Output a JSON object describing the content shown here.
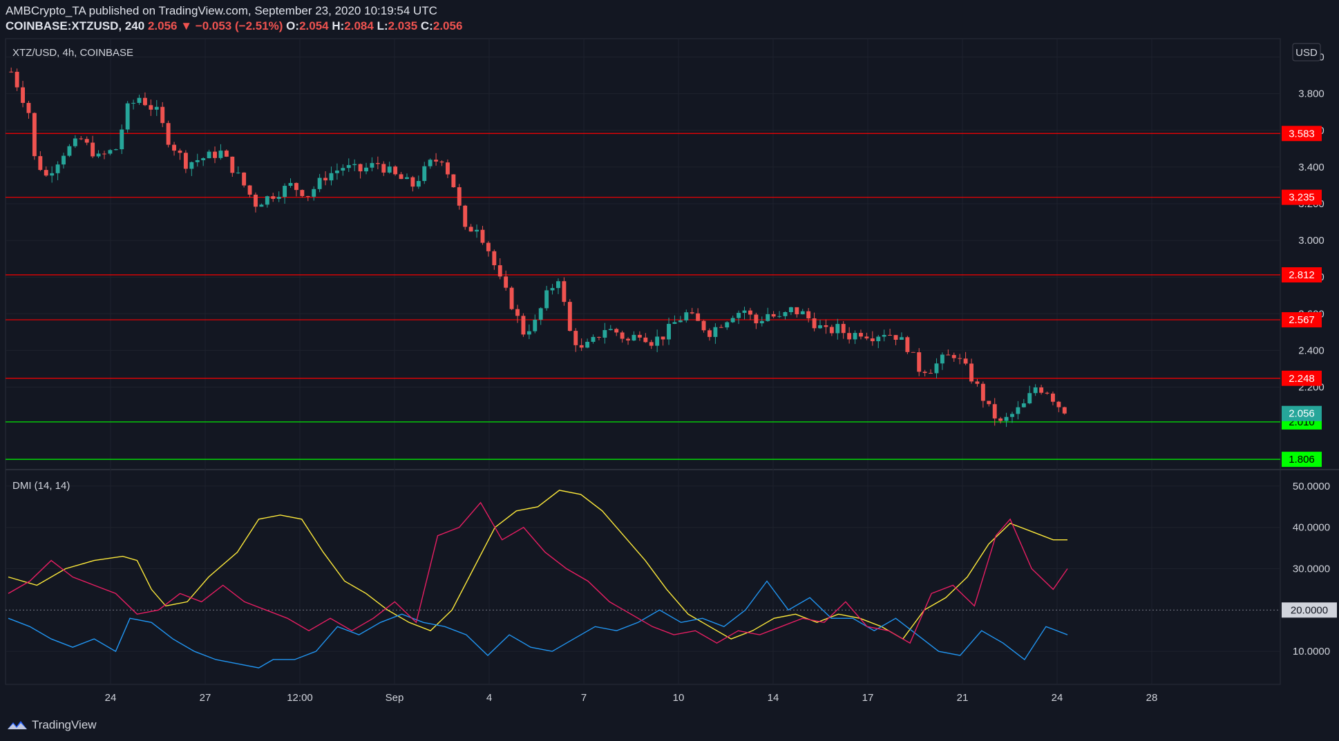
{
  "header": {
    "published_line": "AMBCrypto_TA published on TradingView.com, September 23, 2020 10:19:54 UTC",
    "symbol": "COINBASE:XTZUSD, 240",
    "last": "2.056",
    "change_arrow": "▼",
    "change": "−0.053 (−2.51%)",
    "open_label": "O:",
    "open": "2.054",
    "high_label": "H:",
    "high": "2.084",
    "low_label": "L:",
    "low": "2.035",
    "close_label": "C:",
    "close": "2.056"
  },
  "pane_title": "XTZ/USD, 4h, COINBASE",
  "currency_button": "USD",
  "indicator_title": "DMI (14, 14)",
  "footer_brand": "TradingView",
  "colors": {
    "background": "#131722",
    "up": "#26a69a",
    "down": "#ef5350",
    "resistance": "#ff0000",
    "support": "#00ff00",
    "adx": "#ffeb3b",
    "plus_di": "#2196f3",
    "minus_di": "#e91e63"
  },
  "chart_data": [
    {
      "type": "candlestick",
      "title": "XTZ/USD, 4h, COINBASE",
      "ylim": [
        1.75,
        4.1
      ],
      "y_ticks": [
        "4.000",
        "3.800",
        "3.600",
        "3.400",
        "3.200",
        "3.000",
        "2.800",
        "2.600",
        "2.400",
        "2.200"
      ],
      "x_ticks": [
        "24",
        "27",
        "12:00",
        "Sep",
        "4",
        "7",
        "10",
        "14",
        "17",
        "21",
        "24",
        "28"
      ],
      "close_points": [
        [
          0,
          3.92
        ],
        [
          1,
          3.85
        ],
        [
          3,
          3.7
        ],
        [
          4,
          3.45
        ],
        [
          6,
          3.35
        ],
        [
          9,
          3.48
        ],
        [
          12,
          3.55
        ],
        [
          15,
          3.45
        ],
        [
          18,
          3.5
        ],
        [
          20,
          3.72
        ],
        [
          22,
          3.78
        ],
        [
          25,
          3.7
        ],
        [
          27,
          3.55
        ],
        [
          30,
          3.42
        ],
        [
          33,
          3.45
        ],
        [
          36,
          3.48
        ],
        [
          39,
          3.35
        ],
        [
          42,
          3.2
        ],
        [
          45,
          3.25
        ],
        [
          48,
          3.3
        ],
        [
          51,
          3.25
        ],
        [
          54,
          3.35
        ],
        [
          57,
          3.4
        ],
        [
          60,
          3.38
        ],
        [
          63,
          3.42
        ],
        [
          66,
          3.35
        ],
        [
          69,
          3.3
        ],
        [
          72,
          3.42
        ],
        [
          74,
          3.45
        ],
        [
          76,
          3.3
        ],
        [
          78,
          3.05
        ],
        [
          80,
          3.08
        ],
        [
          82,
          2.95
        ],
        [
          84,
          2.78
        ],
        [
          86,
          2.65
        ],
        [
          88,
          2.5
        ],
        [
          90,
          2.55
        ],
        [
          92,
          2.7
        ],
        [
          94,
          2.8
        ],
        [
          96,
          2.5
        ],
        [
          98,
          2.4
        ],
        [
          100,
          2.45
        ],
        [
          102,
          2.52
        ],
        [
          104,
          2.5
        ],
        [
          106,
          2.45
        ],
        [
          108,
          2.5
        ],
        [
          110,
          2.45
        ],
        [
          112,
          2.48
        ],
        [
          114,
          2.55
        ],
        [
          116,
          2.6
        ],
        [
          118,
          2.55
        ],
        [
          120,
          2.5
        ],
        [
          122,
          2.55
        ],
        [
          124,
          2.6
        ],
        [
          126,
          2.62
        ],
        [
          128,
          2.55
        ],
        [
          130,
          2.6
        ],
        [
          132,
          2.57
        ],
        [
          134,
          2.62
        ],
        [
          136,
          2.6
        ],
        [
          138,
          2.55
        ],
        [
          140,
          2.5
        ],
        [
          142,
          2.52
        ],
        [
          144,
          2.48
        ],
        [
          146,
          2.5
        ],
        [
          148,
          2.48
        ],
        [
          150,
          2.5
        ],
        [
          152,
          2.48
        ],
        [
          154,
          2.42
        ],
        [
          156,
          2.3
        ],
        [
          158,
          2.3
        ],
        [
          160,
          2.35
        ],
        [
          162,
          2.38
        ],
        [
          164,
          2.3
        ],
        [
          166,
          2.2
        ],
        [
          168,
          2.08
        ],
        [
          170,
          2.0
        ],
        [
          172,
          2.05
        ],
        [
          174,
          2.1
        ],
        [
          176,
          2.2
        ],
        [
          178,
          2.18
        ],
        [
          180,
          2.1
        ],
        [
          181,
          2.056
        ]
      ],
      "levels": [
        {
          "value": 3.583,
          "label": "3.583",
          "kind": "resistance"
        },
        {
          "value": 3.235,
          "label": "3.235",
          "kind": "resistance"
        },
        {
          "value": 2.812,
          "label": "2.812",
          "kind": "resistance"
        },
        {
          "value": 2.567,
          "label": "2.567",
          "kind": "resistance"
        },
        {
          "value": 2.248,
          "label": "2.248",
          "kind": "resistance"
        },
        {
          "value": 2.01,
          "label": "2.010",
          "kind": "support"
        },
        {
          "value": 1.806,
          "label": "1.806",
          "kind": "support"
        }
      ],
      "last_price": {
        "value": 2.056,
        "label": "2.056"
      }
    },
    {
      "type": "line",
      "title": "DMI (14, 14)",
      "ylim": [
        2,
        54
      ],
      "y_ticks": [
        "50.0000",
        "40.0000",
        "30.0000",
        "10.0000"
      ],
      "reference": {
        "value": 20,
        "label": "20.0000"
      },
      "series": [
        {
          "key": "adx",
          "points": [
            [
              0,
              28
            ],
            [
              4,
              26
            ],
            [
              8,
              30
            ],
            [
              12,
              32
            ],
            [
              16,
              33
            ],
            [
              18,
              32
            ],
            [
              20,
              25
            ],
            [
              22,
              21
            ],
            [
              25,
              22
            ],
            [
              28,
              28
            ],
            [
              32,
              34
            ],
            [
              35,
              42
            ],
            [
              38,
              43
            ],
            [
              41,
              42
            ],
            [
              44,
              34
            ],
            [
              47,
              27
            ],
            [
              50,
              24
            ],
            [
              53,
              20
            ],
            [
              56,
              17
            ],
            [
              59,
              15
            ],
            [
              62,
              20
            ],
            [
              65,
              30
            ],
            [
              68,
              40
            ],
            [
              71,
              44
            ],
            [
              74,
              45
            ],
            [
              77,
              49
            ],
            [
              80,
              48
            ],
            [
              83,
              44
            ],
            [
              86,
              38
            ],
            [
              89,
              32
            ],
            [
              92,
              25
            ],
            [
              95,
              19
            ],
            [
              98,
              16
            ],
            [
              101,
              13
            ],
            [
              104,
              15
            ],
            [
              107,
              18
            ],
            [
              110,
              19
            ],
            [
              113,
              17
            ],
            [
              116,
              19
            ],
            [
              119,
              18
            ],
            [
              122,
              16
            ],
            [
              125,
              13
            ],
            [
              128,
              20
            ],
            [
              131,
              23
            ],
            [
              134,
              28
            ],
            [
              137,
              36
            ],
            [
              140,
              41
            ],
            [
              143,
              39
            ],
            [
              146,
              37
            ],
            [
              148,
              37
            ]
          ]
        },
        {
          "key": "plus_di",
          "points": [
            [
              0,
              18
            ],
            [
              3,
              16
            ],
            [
              6,
              13
            ],
            [
              9,
              11
            ],
            [
              12,
              13
            ],
            [
              15,
              10
            ],
            [
              17,
              18
            ],
            [
              20,
              17
            ],
            [
              23,
              13
            ],
            [
              26,
              10
            ],
            [
              29,
              8
            ],
            [
              32,
              7
            ],
            [
              35,
              6
            ],
            [
              37,
              8
            ],
            [
              40,
              8
            ],
            [
              43,
              10
            ],
            [
              46,
              16
            ],
            [
              49,
              14
            ],
            [
              52,
              17
            ],
            [
              55,
              19
            ],
            [
              58,
              17
            ],
            [
              61,
              16
            ],
            [
              64,
              14
            ],
            [
              67,
              9
            ],
            [
              70,
              14
            ],
            [
              73,
              11
            ],
            [
              76,
              10
            ],
            [
              79,
              13
            ],
            [
              82,
              16
            ],
            [
              85,
              15
            ],
            [
              88,
              17
            ],
            [
              91,
              20
            ],
            [
              94,
              17
            ],
            [
              97,
              18
            ],
            [
              100,
              16
            ],
            [
              103,
              20
            ],
            [
              106,
              27
            ],
            [
              109,
              20
            ],
            [
              112,
              23
            ],
            [
              115,
              18
            ],
            [
              118,
              18
            ],
            [
              121,
              15
            ],
            [
              124,
              18
            ],
            [
              127,
              14
            ],
            [
              130,
              10
            ],
            [
              133,
              9
            ],
            [
              136,
              15
            ],
            [
              139,
              12
            ],
            [
              142,
              8
            ],
            [
              145,
              16
            ],
            [
              148,
              14
            ]
          ]
        },
        {
          "key": "minus_di",
          "points": [
            [
              0,
              24
            ],
            [
              3,
              27
            ],
            [
              6,
              32
            ],
            [
              9,
              28
            ],
            [
              12,
              26
            ],
            [
              15,
              24
            ],
            [
              18,
              19
            ],
            [
              21,
              20
            ],
            [
              24,
              24
            ],
            [
              27,
              22
            ],
            [
              30,
              26
            ],
            [
              33,
              22
            ],
            [
              36,
              20
            ],
            [
              39,
              18
            ],
            [
              42,
              15
            ],
            [
              45,
              18
            ],
            [
              48,
              15
            ],
            [
              51,
              18
            ],
            [
              54,
              22
            ],
            [
              57,
              17
            ],
            [
              60,
              38
            ],
            [
              63,
              40
            ],
            [
              66,
              46
            ],
            [
              69,
              37
            ],
            [
              72,
              40
            ],
            [
              75,
              34
            ],
            [
              78,
              30
            ],
            [
              81,
              27
            ],
            [
              84,
              22
            ],
            [
              87,
              19
            ],
            [
              90,
              16
            ],
            [
              93,
              14
            ],
            [
              96,
              15
            ],
            [
              99,
              12
            ],
            [
              102,
              15
            ],
            [
              105,
              14
            ],
            [
              108,
              16
            ],
            [
              111,
              18
            ],
            [
              114,
              17
            ],
            [
              117,
              22
            ],
            [
              120,
              16
            ],
            [
              123,
              15
            ],
            [
              126,
              12
            ],
            [
              129,
              24
            ],
            [
              132,
              26
            ],
            [
              135,
              21
            ],
            [
              138,
              38
            ],
            [
              140,
              42
            ],
            [
              143,
              30
            ],
            [
              146,
              25
            ],
            [
              148,
              30
            ]
          ]
        }
      ]
    }
  ]
}
